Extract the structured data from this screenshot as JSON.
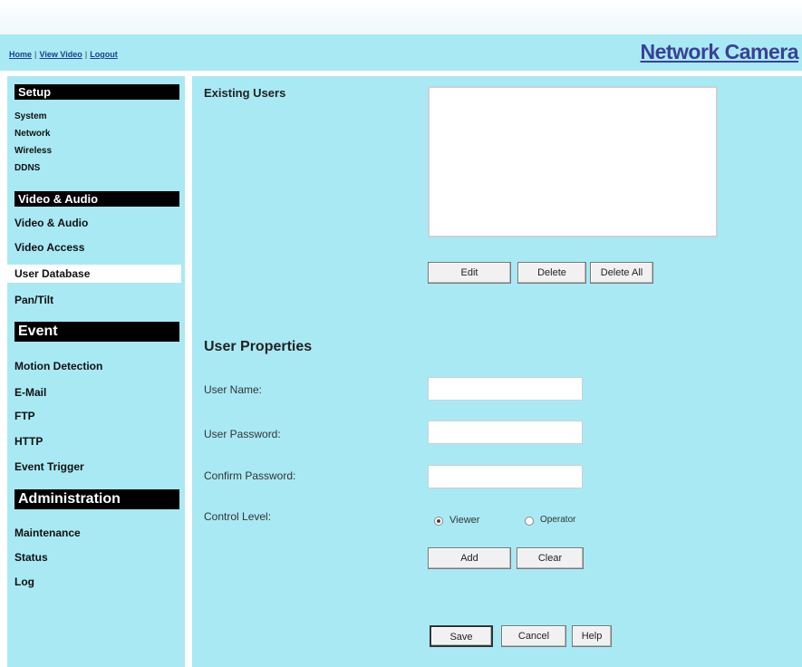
{
  "header": {
    "nav": [
      "Home",
      "View Video",
      "Logout"
    ],
    "brand": "Network Camera"
  },
  "sidebar": {
    "sections": [
      {
        "title": "Setup",
        "items": [
          "System",
          "Network",
          "Wireless",
          "DDNS"
        ]
      },
      {
        "title": "Video & Audio",
        "items": [
          "Video & Audio",
          "Video Access",
          "User Database",
          "Pan/Tilt"
        ]
      },
      {
        "title": "Event",
        "items": [
          "Motion Detection",
          "E-Mail",
          "FTP",
          "HTTP",
          "Event Trigger"
        ]
      },
      {
        "title": "Administration",
        "items": [
          "Maintenance",
          "Status",
          "Log"
        ]
      }
    ],
    "active_item": "User Database"
  },
  "main": {
    "existing_users_label": "Existing Users",
    "existing_users": [],
    "list_buttons": [
      "Edit",
      "Delete",
      "Delete All"
    ],
    "user_properties_title": "User Properties",
    "fields": [
      {
        "label": "User Name:",
        "value": ""
      },
      {
        "label": "User Password:",
        "value": ""
      },
      {
        "label": "Confirm Password:",
        "value": ""
      }
    ],
    "control_level_label": "Control Level:",
    "control_level_options": [
      "Viewer",
      "Operator"
    ],
    "control_level_selected": "Viewer",
    "form_buttons": [
      "Add",
      "Clear"
    ],
    "footer_buttons": [
      "Save",
      "Cancel",
      "Help"
    ]
  }
}
